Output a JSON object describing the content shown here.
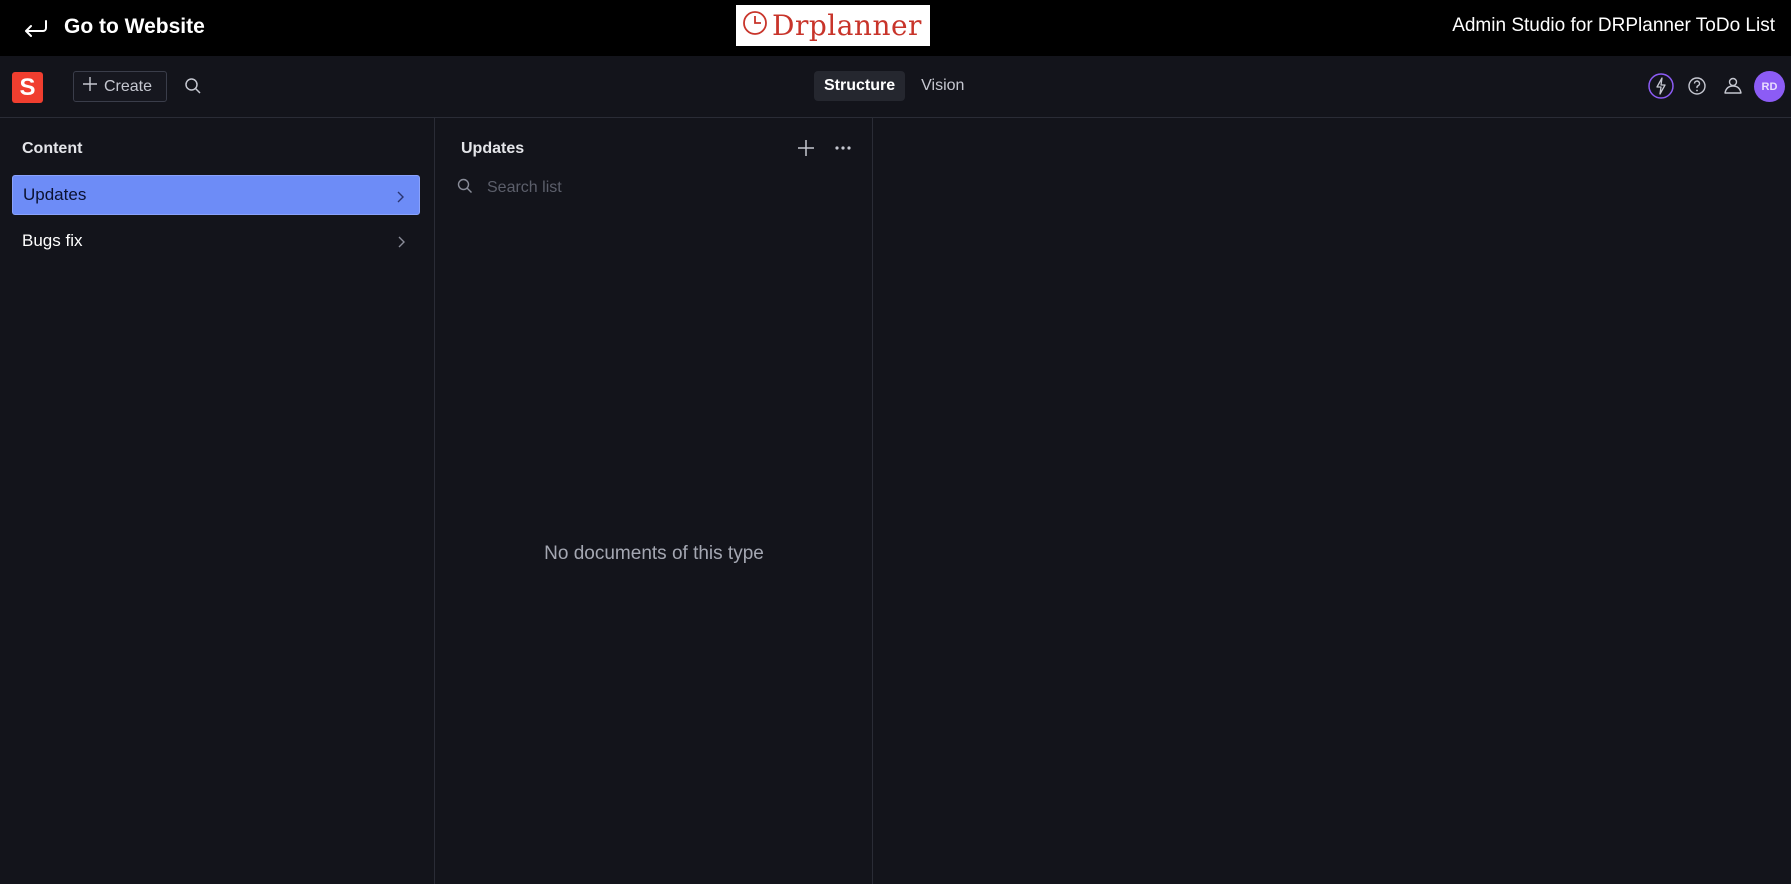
{
  "topbar": {
    "back_label": "Go to Website",
    "logo_text": "Drplanner",
    "studio_title": "Admin Studio for DRPlanner ToDo List"
  },
  "navbar": {
    "brand_letter": "S",
    "create_label": "Create",
    "tools": [
      {
        "label": "Structure",
        "active": true
      },
      {
        "label": "Vision",
        "active": false
      }
    ],
    "avatar_initials": "RD",
    "icons": [
      "search-icon",
      "bolt-icon",
      "help-icon",
      "community-icon"
    ]
  },
  "content_pane": {
    "title": "Content",
    "items": [
      {
        "label": "Updates",
        "selected": true
      },
      {
        "label": "Bugs fix",
        "selected": false
      }
    ]
  },
  "documents_pane": {
    "title": "Updates",
    "search_placeholder": "Search list",
    "empty_message": "No documents of this type"
  },
  "colors": {
    "background": "#13141b",
    "accent_selected": "#6d8cf7",
    "brand": "#f03e2f",
    "avatar": "#8c5cf5",
    "logo_red": "#c8342a"
  }
}
